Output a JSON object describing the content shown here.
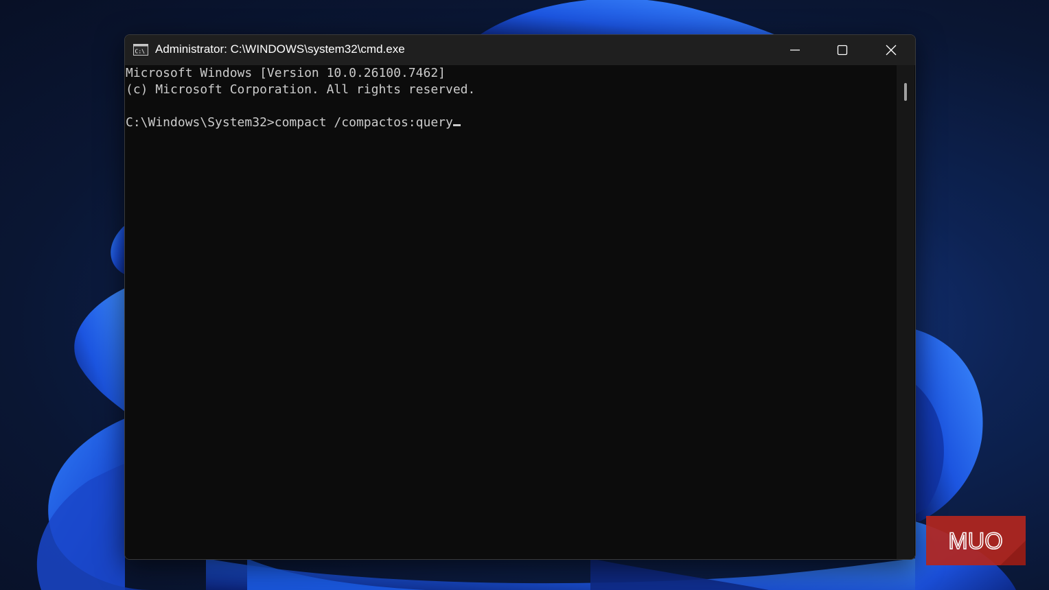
{
  "window": {
    "title": "Administrator: C:\\WINDOWS\\system32\\cmd.exe",
    "app_icon": "cmd-icon",
    "buttons": {
      "minimize": "minimize-icon",
      "maximize": "maximize-icon",
      "close": "close-icon"
    }
  },
  "console": {
    "lines": [
      "Microsoft Windows [Version 10.0.26100.7462]",
      "(c) Microsoft Corporation. All rights reserved.",
      "",
      "C:\\Windows\\System32>compact /compactos:query"
    ]
  },
  "watermark": {
    "text": "MUO"
  },
  "colors": {
    "console_bg": "#0c0c0c",
    "console_fg": "#cccccc",
    "titlebar_bg": "#1f1f1f",
    "logo_red": "#b3261e"
  }
}
